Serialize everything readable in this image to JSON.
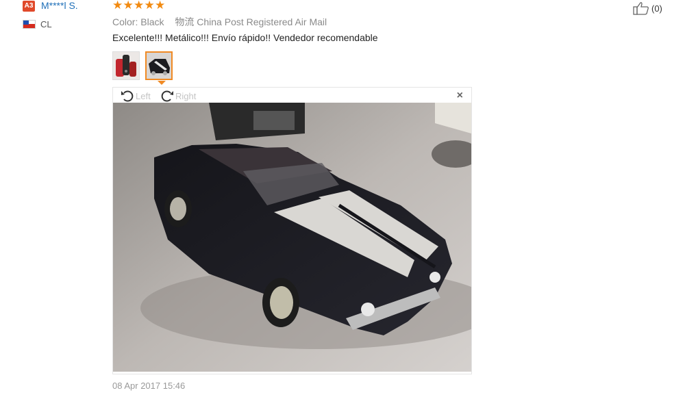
{
  "user": {
    "level": "A3",
    "name": "M****l S.",
    "country": "CL"
  },
  "review": {
    "rating": 5,
    "color_label": "Color:",
    "color_value": "Black",
    "shipping_label": "物流",
    "shipping_value": "China Post Registered Air Mail",
    "text": "Excelente!!! Metálico!!! Envío rápido!! Vendedor recomendable",
    "date": "08 Apr 2017 15:46"
  },
  "viewer": {
    "rotate_left": "Left",
    "rotate_right": "Right",
    "close": "×"
  },
  "helpful": {
    "count": "(0)"
  },
  "colors": {
    "accent": "#f08a24",
    "link": "#1e6fb8",
    "badge": "#e0492a"
  }
}
